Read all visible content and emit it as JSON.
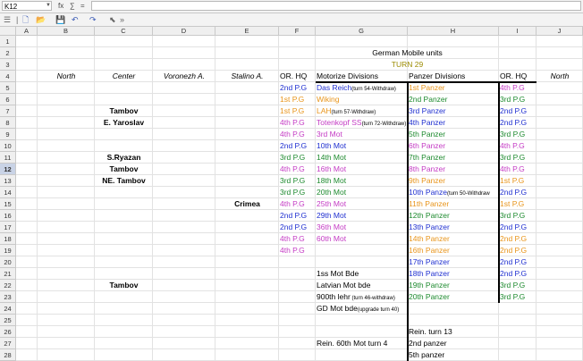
{
  "formula_bar": {
    "cell_ref": "K12",
    "fx": "fx",
    "sum": "∑",
    "eq": "="
  },
  "columns": [
    "A",
    "B",
    "C",
    "D",
    "E",
    "F",
    "G",
    "H",
    "I",
    "J"
  ],
  "rows": [
    "1",
    "2",
    "3",
    "4",
    "5",
    "6",
    "7",
    "8",
    "9",
    "10",
    "11",
    "12",
    "13",
    "14",
    "15",
    "16",
    "17",
    "18",
    "19",
    "20",
    "21",
    "22",
    "23",
    "24",
    "25",
    "26",
    "27",
    "28"
  ],
  "active_row": "12",
  "title": "German Mobile units",
  "turn": "TURN 29",
  "headers": {
    "north": "North",
    "center": "Center",
    "voronezh": "Voronezh A.",
    "stalino": "Stalino A.",
    "or_hq_1": "OR. HQ",
    "motorize": "Motorize Divisions",
    "panzer": "Panzer Divisions",
    "or_hq_2": "OR. HQ",
    "north_2": "North"
  },
  "c_col": [
    {
      "row": 7,
      "text": "Tambov"
    },
    {
      "row": 8,
      "text": "E. Yaroslav"
    },
    {
      "row": 11,
      "text": "S.Ryazan"
    },
    {
      "row": 12,
      "text": "Tambov"
    },
    {
      "row": 13,
      "text": "NE. Tambov"
    },
    {
      "row": 22,
      "text": "Tambov"
    }
  ],
  "e_col": [
    {
      "row": 15,
      "text": "Crimea"
    }
  ],
  "f_col": [
    {
      "row": 5,
      "text": "2nd P.G",
      "color": "blue"
    },
    {
      "row": 6,
      "text": "1st P.G",
      "color": "orange"
    },
    {
      "row": 7,
      "text": "1st P.G",
      "color": "orange"
    },
    {
      "row": 8,
      "text": "4th P.G",
      "color": "magenta"
    },
    {
      "row": 9,
      "text": "4th P.G",
      "color": "magenta"
    },
    {
      "row": 10,
      "text": "2nd P.G",
      "color": "blue"
    },
    {
      "row": 11,
      "text": "3rd P.G",
      "color": "green"
    },
    {
      "row": 12,
      "text": "4th P.G",
      "color": "magenta"
    },
    {
      "row": 13,
      "text": "3rd P.G",
      "color": "green"
    },
    {
      "row": 14,
      "text": "3rd P.G",
      "color": "green"
    },
    {
      "row": 15,
      "text": "4th P.G",
      "color": "magenta"
    },
    {
      "row": 16,
      "text": "2nd P.G",
      "color": "blue"
    },
    {
      "row": 17,
      "text": "2nd P.G",
      "color": "blue"
    },
    {
      "row": 18,
      "text": "4th P.G",
      "color": "magenta"
    },
    {
      "row": 19,
      "text": "4th P.G",
      "color": "magenta"
    }
  ],
  "g_col": [
    {
      "row": 5,
      "text": "Das Reich",
      "note": "(turn 54-Withdraw)",
      "color": "blue"
    },
    {
      "row": 6,
      "text": "Wiking",
      "note": "",
      "color": "orange"
    },
    {
      "row": 7,
      "text": "LAH",
      "note": "(turn 57-Withdraw)",
      "color": "orange"
    },
    {
      "row": 8,
      "text": "Totenkopf SS",
      "note": "(turn 72-Withdraw)",
      "color": "magenta"
    },
    {
      "row": 9,
      "text": "3rd Mot",
      "note": "",
      "color": "magenta"
    },
    {
      "row": 10,
      "text": "10th Mot",
      "note": "",
      "color": "blue"
    },
    {
      "row": 11,
      "text": "14th Mot",
      "note": "",
      "color": "green"
    },
    {
      "row": 12,
      "text": "16th Mot",
      "note": "",
      "color": "magenta"
    },
    {
      "row": 13,
      "text": "18th Mot",
      "note": "",
      "color": "green"
    },
    {
      "row": 14,
      "text": "20th Mot",
      "note": "",
      "color": "green"
    },
    {
      "row": 15,
      "text": "25th Mot",
      "note": "",
      "color": "magenta"
    },
    {
      "row": 16,
      "text": "29th Mot",
      "note": "",
      "color": "blue"
    },
    {
      "row": 17,
      "text": "36th Mot",
      "note": "",
      "color": "magenta"
    },
    {
      "row": 18,
      "text": "60th Mot",
      "note": "",
      "color": "magenta"
    },
    {
      "row": 21,
      "text": "1ss Mot Bde",
      "note": "",
      "color": "black"
    },
    {
      "row": 22,
      "text": "Latvian Mot bde",
      "note": "",
      "color": "black"
    },
    {
      "row": 23,
      "text": "900th lehr",
      "note": " (turn 46-withdraw)",
      "color": "black"
    },
    {
      "row": 24,
      "text": "GD Mot bde",
      "note": "(upgrade turn 40)",
      "color": "black"
    },
    {
      "row": 27,
      "text": "Rein. 60th Mot turn 4",
      "note": "",
      "color": "black"
    }
  ],
  "h_col": [
    {
      "row": 5,
      "text": "1st Panzer",
      "note": "",
      "color": "orange"
    },
    {
      "row": 6,
      "text": "2nd Panzer",
      "note": "",
      "color": "green"
    },
    {
      "row": 7,
      "text": "3rd Panzer",
      "note": "",
      "color": "blue"
    },
    {
      "row": 8,
      "text": "4th Panzer",
      "note": "",
      "color": "blue"
    },
    {
      "row": 9,
      "text": "5th Panzer",
      "note": "",
      "color": "green"
    },
    {
      "row": 10,
      "text": "6th Panzer",
      "note": "",
      "color": "magenta"
    },
    {
      "row": 11,
      "text": "7th Panzer",
      "note": "",
      "color": "green"
    },
    {
      "row": 12,
      "text": "8th Panzer",
      "note": "",
      "color": "magenta"
    },
    {
      "row": 13,
      "text": "9th Panzer",
      "note": "",
      "color": "orange"
    },
    {
      "row": 14,
      "text": "10th Panze",
      "note": "(turn 50-Withdraw",
      "color": "blue"
    },
    {
      "row": 15,
      "text": "11th Panzer",
      "note": "",
      "color": "orange"
    },
    {
      "row": 16,
      "text": "12th Panzer",
      "note": "",
      "color": "green"
    },
    {
      "row": 17,
      "text": "13th Panzer",
      "note": "",
      "color": "blue"
    },
    {
      "row": 18,
      "text": "14th Panzer",
      "note": "",
      "color": "orange"
    },
    {
      "row": 19,
      "text": "16th Panzer",
      "note": "",
      "color": "orange"
    },
    {
      "row": 20,
      "text": "17th Panzer",
      "note": "",
      "color": "blue"
    },
    {
      "row": 21,
      "text": "18th Panzer",
      "note": "",
      "color": "blue"
    },
    {
      "row": 22,
      "text": "19th Panzer",
      "note": "",
      "color": "green"
    },
    {
      "row": 23,
      "text": "20th Panzer",
      "note": "",
      "color": "green"
    },
    {
      "row": 26,
      "text": "Rein. turn 13",
      "note": "",
      "color": "black"
    },
    {
      "row": 27,
      "text": "2nd panzer",
      "note": "",
      "color": "black"
    },
    {
      "row": 28,
      "text": "5th panzer",
      "note": "",
      "color": "black"
    }
  ],
  "i_col": [
    {
      "row": 5,
      "text": "4th P.G",
      "color": "magenta"
    },
    {
      "row": 6,
      "text": "3rd P.G",
      "color": "green"
    },
    {
      "row": 7,
      "text": "2nd P.G",
      "color": "blue"
    },
    {
      "row": 8,
      "text": "2nd P.G",
      "color": "blue"
    },
    {
      "row": 9,
      "text": "3rd P.G",
      "color": "green"
    },
    {
      "row": 10,
      "text": "4th P.G",
      "color": "magenta"
    },
    {
      "row": 11,
      "text": "3rd P.G",
      "color": "green"
    },
    {
      "row": 12,
      "text": "4th P.G",
      "color": "magenta"
    },
    {
      "row": 13,
      "text": "1st P.G",
      "color": "orange"
    },
    {
      "row": 14,
      "text": "2nd P.G",
      "color": "blue"
    },
    {
      "row": 15,
      "text": "1st P.G",
      "color": "orange"
    },
    {
      "row": 16,
      "text": "3rd P.G",
      "color": "green"
    },
    {
      "row": 17,
      "text": "2nd P.G",
      "color": "blue"
    },
    {
      "row": 18,
      "text": "2nd P.G",
      "color": "orange"
    },
    {
      "row": 19,
      "text": "2nd P.G",
      "color": "orange"
    },
    {
      "row": 20,
      "text": "2nd P.G",
      "color": "blue"
    },
    {
      "row": 21,
      "text": "2nd P.G",
      "color": "blue"
    },
    {
      "row": 22,
      "text": "3rd P.G",
      "color": "green"
    },
    {
      "row": 23,
      "text": "3rd P.G",
      "color": "green"
    }
  ]
}
